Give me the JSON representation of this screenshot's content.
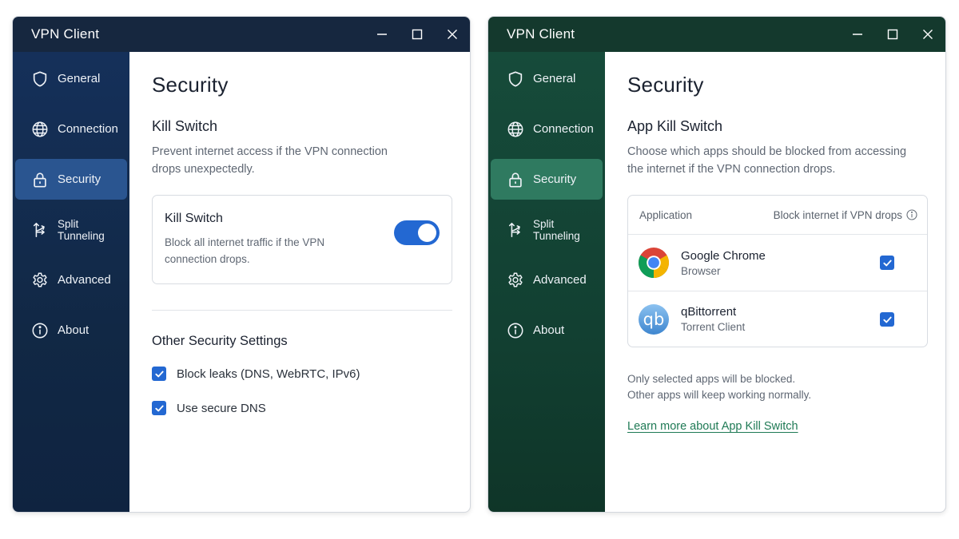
{
  "left_window": {
    "title": "VPN Client",
    "sidebar": [
      {
        "label": "General",
        "icon": "shield-icon"
      },
      {
        "label": "Connection",
        "icon": "globe-icon"
      },
      {
        "label": "Security",
        "icon": "lock-icon",
        "active": true
      },
      {
        "label": "Split Tunneling",
        "icon": "split-tunnel-icon"
      },
      {
        "label": "Advanced",
        "icon": "gear-icon"
      },
      {
        "label": "About",
        "icon": "info-icon"
      }
    ],
    "page_title": "Security",
    "kill_switch": {
      "section_title": "Kill Switch",
      "section_desc": "Prevent internet access if the VPN connection drops unexpectedly.",
      "card_title": "Kill Switch",
      "card_desc": "Block all internet traffic if the VPN connection drops.",
      "enabled": true
    },
    "other": {
      "title": "Other Security Settings",
      "options": [
        {
          "label": "Block leaks (DNS, WebRTC, IPv6)",
          "checked": true
        },
        {
          "label": "Use secure DNS",
          "checked": true
        }
      ]
    },
    "accent_color": "#2368d2",
    "sidebar_color": "#13294a"
  },
  "right_window": {
    "title": "VPN Client",
    "sidebar": [
      {
        "label": "General",
        "icon": "shield-icon"
      },
      {
        "label": "Connection",
        "icon": "globe-icon"
      },
      {
        "label": "Security",
        "icon": "lock-icon",
        "active": true
      },
      {
        "label": "Split Tunneling",
        "icon": "split-tunnel-icon"
      },
      {
        "label": "Advanced",
        "icon": "gear-icon"
      },
      {
        "label": "About",
        "icon": "info-icon"
      }
    ],
    "page_title": "Security",
    "app_kill_switch": {
      "section_title": "App Kill Switch",
      "section_desc": "Choose which apps should be blocked from accessing the internet if the VPN connection drops.",
      "table_header_app": "Application",
      "table_header_block": "Block internet if VPN drops",
      "apps": [
        {
          "name": "Google Chrome",
          "type": "Browser",
          "icon": "chrome-icon",
          "checked": true
        },
        {
          "name": "qBittorrent",
          "type": "Torrent Client",
          "icon": "qbittorrent-icon",
          "icon_text": "qb",
          "checked": true
        }
      ],
      "note_line1": "Only selected apps will be blocked.",
      "note_line2": "Other apps will keep working normally.",
      "learn_more": "Learn more about App Kill Switch"
    },
    "accent_color": "#1f7a55",
    "sidebar_color": "#143f31"
  }
}
